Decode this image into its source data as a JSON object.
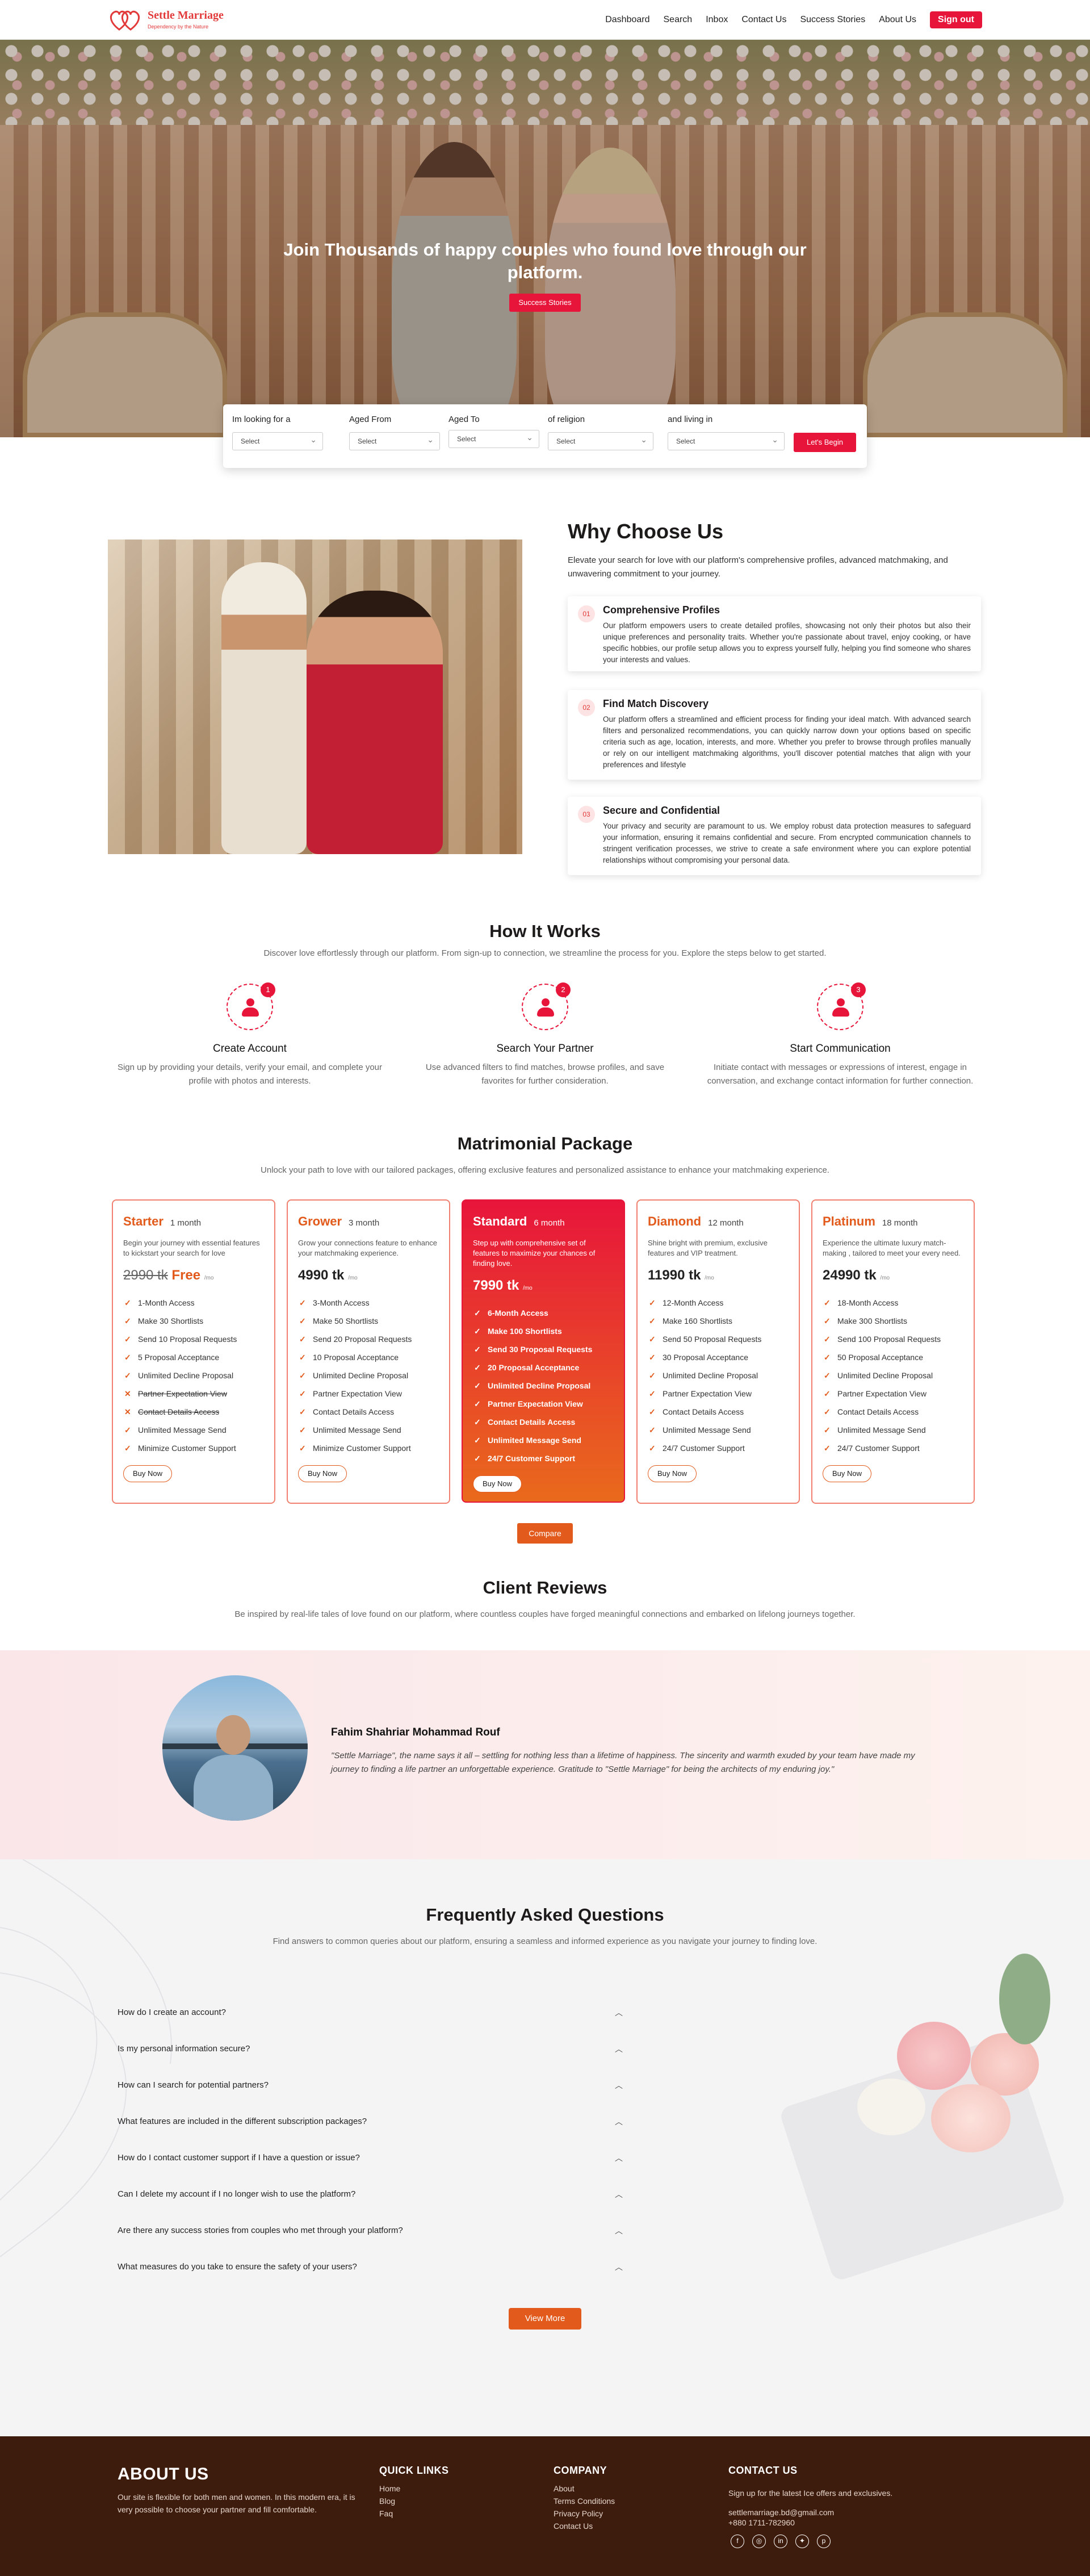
{
  "header": {
    "brand": "Settle Marriage",
    "tagline": "Dependency by the Nature",
    "nav": [
      "Dashboard",
      "Search",
      "Inbox",
      "Contact Us",
      "Success Stories",
      "About Us"
    ],
    "signout": "Sign out"
  },
  "hero": {
    "title": "Join Thousands of happy couples who found love through our platform.",
    "button": "Success Stories"
  },
  "search": {
    "fields": [
      {
        "label": "Im looking for a",
        "value": "Select"
      },
      {
        "label": "Aged From",
        "value": "Select"
      },
      {
        "label": "Aged To",
        "value": "Select"
      },
      {
        "label": "of religion",
        "value": "Select"
      },
      {
        "label": "and living in",
        "value": "Select"
      }
    ],
    "submit": "Let's Begin"
  },
  "why": {
    "title": "Why Choose Us",
    "description": "Elevate your search for love with our platform's comprehensive profiles, advanced matchmaking, and unwavering commitment to your journey.",
    "cards": [
      {
        "num": "01",
        "title": "Comprehensive Profiles",
        "text": "Our platform empowers users to create detailed profiles, showcasing not only their photos but also their unique preferences and personality traits. Whether you're passionate about travel, enjoy cooking, or have specific hobbies, our profile setup allows you to express yourself fully, helping you find someone who shares your interests and values."
      },
      {
        "num": "02",
        "title": "Find Match Discovery",
        "text": "Our platform offers a streamlined and efficient process for finding your ideal match. With advanced search filters and personalized recommendations, you can quickly narrow down your options based on specific criteria such as age, location, interests, and more. Whether you prefer to browse through profiles manually or rely on our intelligent matchmaking algorithms, you'll discover potential matches that align with your preferences and lifestyle"
      },
      {
        "num": "03",
        "title": "Secure and Confidential",
        "text": "Your privacy and security are paramount to us. We employ robust data protection measures to safeguard your information, ensuring it remains confidential and secure. From encrypted communication channels to stringent verification processes, we strive to create a safe environment where you can explore potential relationships without compromising your personal data."
      }
    ]
  },
  "how": {
    "title": "How It Works",
    "subtitle": "Discover love effortlessly through our platform. From sign-up to connection, we streamline the process for you. Explore the steps below to get started.",
    "steps": [
      {
        "badge": "1",
        "title": "Create Account",
        "text": "Sign up by providing your details, verify your email, and complete your profile with photos and interests."
      },
      {
        "badge": "2",
        "title": "Search Your Partner",
        "text": "Use advanced filters to find matches, browse profiles, and save favorites for further consideration."
      },
      {
        "badge": "3",
        "title": "Start Communication",
        "text": "Initiate contact with messages or expressions of interest, engage in conversation, and exchange contact information for further connection."
      }
    ]
  },
  "packages": {
    "title": "Matrimonial Package",
    "subtitle": "Unlock your path to love with our tailored packages, offering exclusive features and personalized assistance to enhance your matchmaking experience.",
    "items": [
      {
        "name": "Starter",
        "duration": "1 month",
        "desc": "Begin your journey with essential features to kickstart your search for love",
        "old_price": "2990 tk",
        "price": "Free",
        "per": "/mo",
        "features": [
          "1-Month Access",
          "Make 30 Shortlists",
          "Send 10 Proposal Requests",
          "5 Proposal Acceptance",
          "Unlimited Decline Proposal",
          "Partner Expectation View",
          "Contact Details Access",
          "Unlimited Message Send",
          "Minimize Customer Support"
        ],
        "buy": "Buy Now"
      },
      {
        "name": "Grower",
        "duration": "3 month",
        "desc": "Grow your connections feature to enhance your matchmaking experience.",
        "price": "4990 tk",
        "per": "/mo",
        "features": [
          "3-Month Access",
          "Make 50 Shortlists",
          "Send 20 Proposal Requests",
          "10 Proposal Acceptance",
          "Unlimited Decline Proposal",
          "Partner Expectation View",
          "Contact Details Access",
          "Unlimited Message Send",
          "Minimize Customer Support"
        ],
        "buy": "Buy Now"
      },
      {
        "name": "Standard",
        "duration": "6 month",
        "desc": "Step up with comprehensive set of features to maximize your chances of finding love.",
        "price": "7990 tk",
        "per": "/mo",
        "features": [
          "6-Month Access",
          "Make 100 Shortlists",
          "Send 30 Proposal Requests",
          "20 Proposal Acceptance",
          "Unlimited Decline Proposal",
          "Partner Expectation View",
          "Contact Details Access",
          "Unlimited Message Send",
          "24/7 Customer Support"
        ],
        "buy": "Buy Now"
      },
      {
        "name": "Diamond",
        "duration": "12 month",
        "desc": "Shine bright with premium, exclusive features and VIP treatment.",
        "price": "11990 tk",
        "per": "/mo",
        "features": [
          "12-Month Access",
          "Make 160 Shortlists",
          "Send 50 Proposal Requests",
          "30 Proposal Acceptance",
          "Unlimited Decline Proposal",
          "Partner Expectation View",
          "Contact Details Access",
          "Unlimited Message Send",
          "24/7 Customer Support"
        ],
        "buy": "Buy Now"
      },
      {
        "name": "Platinum",
        "duration": "18 month",
        "desc": "Experience the ultimate luxury match-making , tailored to meet your every need.",
        "price": "24990 tk",
        "per": "/mo",
        "features": [
          "18-Month Access",
          "Make 300 Shortlists",
          "Send 100 Proposal Requests",
          "50 Proposal Acceptance",
          "Unlimited Decline Proposal",
          "Partner Expectation View",
          "Contact Details Access",
          "Unlimited Message Send",
          "24/7 Customer Support"
        ],
        "buy": "Buy Now"
      }
    ],
    "compare": "Compare"
  },
  "reviews": {
    "title": "Client Reviews",
    "subtitle": "Be inspired by real-life tales of love found on our platform, where countless couples have forged meaningful connections and embarked on lifelong journeys together.",
    "name": "Fahim Shahriar Mohammad Rouf",
    "text": "\"Settle Marriage\", the name says it all – settling for nothing less than a lifetime of happiness. The sincerity and warmth exuded by your team have made my journey to finding a life partner an unforgettable experience. Gratitude to \"Settle Marriage\" for being the architects of my enduring joy.\""
  },
  "faq": {
    "title": "Frequently Asked Questions",
    "subtitle": "Find answers to common queries about our platform, ensuring a seamless and informed experience as you navigate your journey to finding love.",
    "items": [
      "How do I create an account?",
      "Is my personal information secure?",
      "How can I search for potential partners?",
      "What features are included in the different subscription packages?",
      "How do I contact customer support if I have a question or issue?",
      "Can I delete my account if I no longer wish to use the platform?",
      "Are there any success stories from couples who met through your platform?",
      "What measures do you take to ensure the safety of your users?"
    ],
    "view_more": "View More"
  },
  "footer": {
    "about_title": "ABOUT US",
    "about_text": "Our site is flexible for both men and women. In this modern era, it is very possible to choose your partner and fill comfortable.",
    "quick_title": "QUICK LINKS",
    "quick_links": [
      "Home",
      "Blog",
      "Faq"
    ],
    "company_title": "COMPANY",
    "company_links": [
      "About",
      "Terms Conditions",
      "Privacy Policy",
      "Contact Us"
    ],
    "contact_title": "CONTACT US",
    "contact_text": "Sign up for the latest Ice offers and exclusives.",
    "email": "settlemarriage.bd@gmail.com",
    "phone": "+880 1711-782960",
    "social_icons": [
      "facebook-icon",
      "instagram-icon",
      "linkedin-icon",
      "twitter-icon",
      "pinterest-icon"
    ]
  }
}
